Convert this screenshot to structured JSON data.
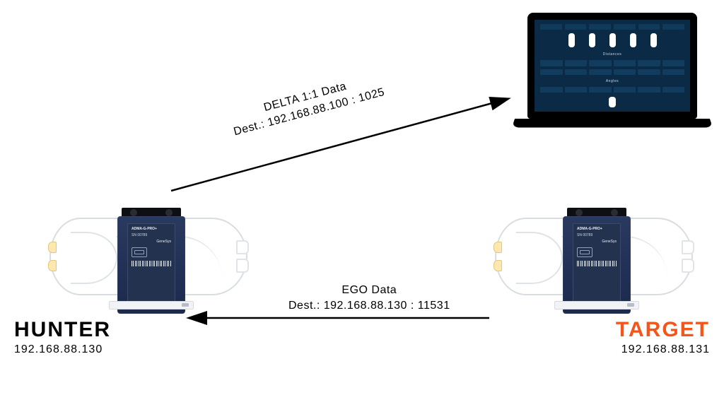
{
  "laptop": {
    "section_distances": "Distances",
    "section_angles": "Angles"
  },
  "device": {
    "model": "ADMA-G-PRO+",
    "serial": "SN 00789",
    "brand": "GeneSys"
  },
  "arrows": {
    "delta": {
      "line1": "DELTA 1:1 Data",
      "line2": "Dest.: 192.168.88.100 : 1025"
    },
    "ego": {
      "line1": "EGO Data",
      "line2": "Dest.: 192.168.88.130 : 11531"
    }
  },
  "nodes": {
    "hunter": {
      "name": "HUNTER",
      "ip": "192.168.88.130"
    },
    "target": {
      "name": "TARGET",
      "ip": "192.168.88.131"
    }
  }
}
